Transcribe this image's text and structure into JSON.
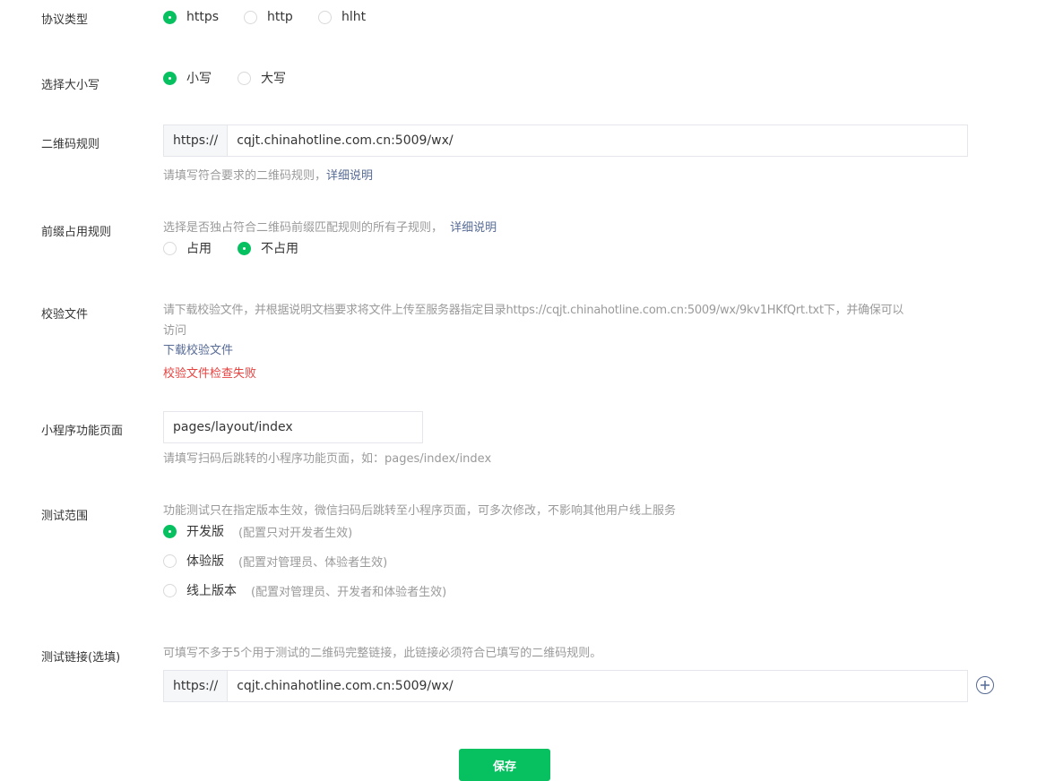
{
  "protocol": {
    "label": "协议类型",
    "options": [
      "https",
      "http",
      "hlht"
    ],
    "selected": "https"
  },
  "case": {
    "label": "选择大小写",
    "options": [
      "小写",
      "大写"
    ],
    "selected": "小写"
  },
  "qr_rule": {
    "label": "二维码规则",
    "prefix": "https://",
    "value": "cqjt.chinahotline.com.cn:5009/wx/",
    "hint": "请填写符合要求的二维码规则，",
    "hint_link": "详细说明"
  },
  "prefix_rule": {
    "label": "前缀占用规则",
    "hint": "选择是否独占符合二维码前缀匹配规则的所有子规则，",
    "hint_link": "详细说明",
    "options": [
      "占用",
      "不占用"
    ],
    "selected": "不占用"
  },
  "verify_file": {
    "label": "校验文件",
    "hint_line1": "请下载校验文件，并根据说明文档要求将文件上传至服务器指定目录https://cqjt.chinahotline.com.cn:5009/wx/9kv1HKfQrt.txt下，并确保可以",
    "hint_line2": "访问",
    "download_link": "下载校验文件",
    "error": "校验文件检查失败"
  },
  "mini_page": {
    "label": "小程序功能页面",
    "value": "pages/layout/index",
    "hint": "请填写扫码后跳转的小程序功能页面，如：pages/index/index"
  },
  "test_scope": {
    "label": "测试范围",
    "hint": "功能测试只在指定版本生效，微信扫码后跳转至小程序页面，可多次修改，不影响其他用户线上服务",
    "options": [
      {
        "name": "开发版",
        "note": "(配置只对开发者生效)"
      },
      {
        "name": "体验版",
        "note": "(配置对管理员、体验者生效)"
      },
      {
        "name": "线上版本",
        "note": "(配置对管理员、开发者和体验者生效)"
      }
    ],
    "selected": "开发版"
  },
  "test_link": {
    "label": "测试链接(选填)",
    "hint": "可填写不多于5个用于测试的二维码完整链接，此链接必须符合已填写的二维码规则。",
    "prefix": "https://",
    "value": "cqjt.chinahotline.com.cn:5009/wx/"
  },
  "save_label": "保存",
  "colors": {
    "accent": "#07c160",
    "link": "#576b95",
    "error": "#e64340"
  }
}
